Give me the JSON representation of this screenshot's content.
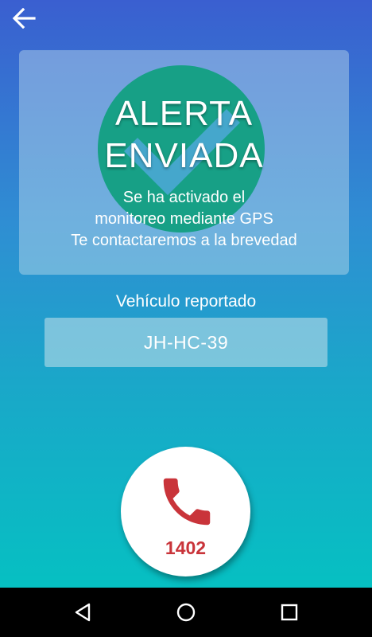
{
  "header": {
    "back_icon": "arrow-left-icon"
  },
  "alert_card": {
    "title_line1": "ALERTA",
    "title_line2": "ENVIADA",
    "message_line1": "Se ha activado el",
    "message_line2": "monitoreo mediante GPS",
    "message_line3": "Te contactaremos a la brevedad",
    "icon": "check-circle-icon",
    "circle_color": "#17a086"
  },
  "vehicle": {
    "label": "Vehículo reportado",
    "plate": "JH-HC-39"
  },
  "call_button": {
    "icon": "phone-icon",
    "number": "1402",
    "accent_color": "#c9343a"
  },
  "navigation_bar": {
    "back_icon": "triangle-back-icon",
    "home_icon": "circle-home-icon",
    "recent_icon": "square-recents-icon"
  }
}
